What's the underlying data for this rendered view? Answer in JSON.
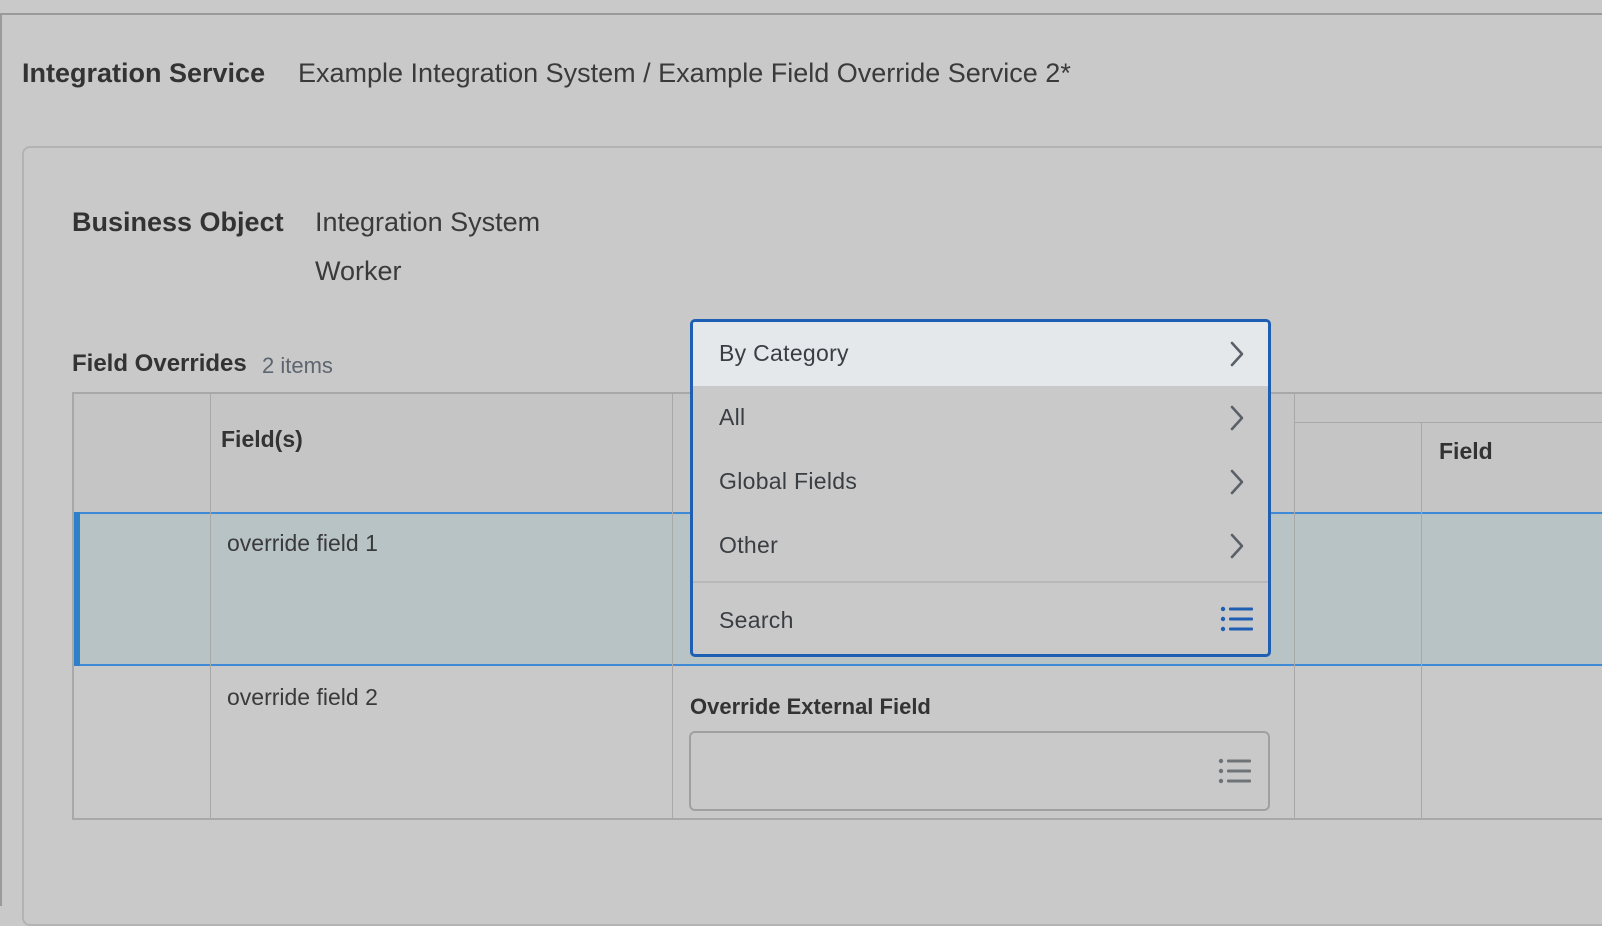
{
  "header": {
    "label": "Integration Service",
    "value": "Example Integration System / Example Field Override Service 2*"
  },
  "business_object": {
    "label": "Business Object",
    "values": [
      "Integration System",
      "Worker"
    ]
  },
  "field_overrides": {
    "title": "Field Overrides",
    "count": "2 items",
    "columns": {
      "fields": "Field(s)",
      "field": "Field"
    },
    "rows": [
      {
        "field": "override field 1",
        "selected": true
      },
      {
        "field": "override field 2",
        "selected": false
      }
    ],
    "override_external_field_label": "Override External Field",
    "override_external_field_value": ""
  },
  "dropdown": {
    "items": [
      {
        "label": "By Category",
        "icon": "chevron-right-icon"
      },
      {
        "label": "All",
        "icon": "chevron-right-icon"
      },
      {
        "label": "Global Fields",
        "icon": "chevron-right-icon"
      },
      {
        "label": "Other",
        "icon": "chevron-right-icon"
      }
    ],
    "search_placeholder": "Search",
    "search_icon": "list-icon"
  },
  "colors": {
    "accent": "#1f5fb3",
    "selected_row": "#b8c3c6",
    "active_menu_item": "#e4e8eb",
    "background": "#c9c9c9"
  }
}
